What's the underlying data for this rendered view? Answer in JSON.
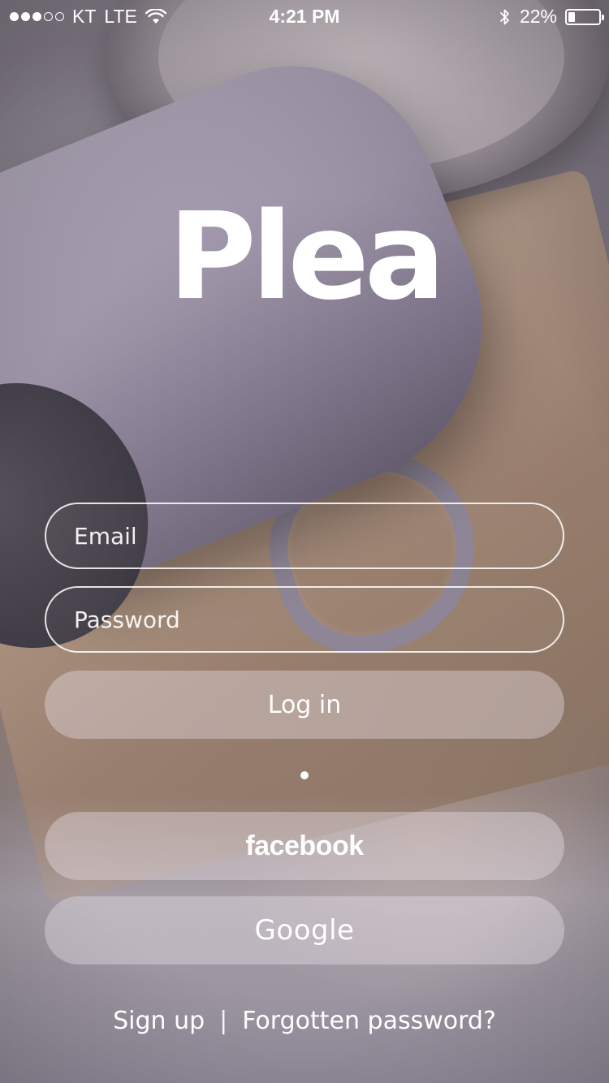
{
  "status_bar": {
    "signal_strength": 3,
    "signal_max": 5,
    "carrier": "KT",
    "network": "LTE",
    "time": "4:21 PM",
    "battery_percent": "22%",
    "battery_level": 0.22,
    "icons": [
      "signal-dots-icon",
      "wifi-icon",
      "bluetooth-icon",
      "battery-icon"
    ]
  },
  "logo": {
    "text": "Plea"
  },
  "form": {
    "email_placeholder": "Email",
    "password_placeholder": "Password",
    "login_label": "Log in"
  },
  "social": {
    "facebook_label": "facebook",
    "google_label": "Google"
  },
  "footer": {
    "signup_label": "Sign up",
    "separator": "|",
    "forgot_label": "Forgotten password?"
  },
  "colors": {
    "text": "#ffffff",
    "field_border": "#ffffff",
    "button_fill": "rgba(236,230,236,0.38)"
  }
}
